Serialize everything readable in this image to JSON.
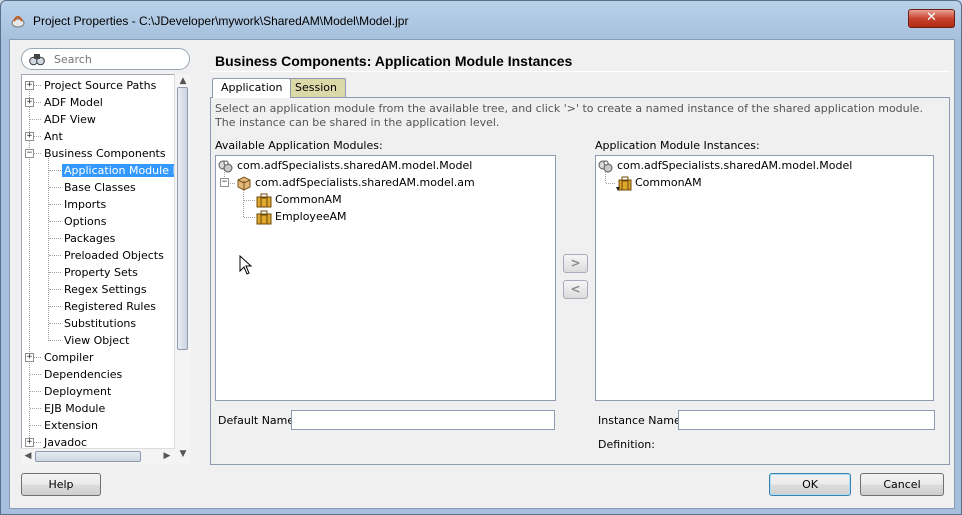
{
  "window": {
    "title": "Project Properties - C:\\JDeveloper\\mywork\\SharedAM\\Model\\Model.jpr",
    "close_label": "✕"
  },
  "search": {
    "placeholder": "Search",
    "value": ""
  },
  "nav": {
    "items": [
      {
        "label": "Project Source Paths",
        "expander": "+"
      },
      {
        "label": "ADF Model",
        "expander": "+"
      },
      {
        "label": "ADF View"
      },
      {
        "label": "Ant",
        "expander": "+"
      },
      {
        "label": "Business Components",
        "expander": "−"
      },
      {
        "label": "Application Module Inst",
        "selected": true
      },
      {
        "label": "Base Classes"
      },
      {
        "label": "Imports"
      },
      {
        "label": "Options"
      },
      {
        "label": "Packages"
      },
      {
        "label": "Preloaded Objects"
      },
      {
        "label": "Property Sets"
      },
      {
        "label": "Regex Settings"
      },
      {
        "label": "Registered Rules"
      },
      {
        "label": "Substitutions"
      },
      {
        "label": "View Object"
      },
      {
        "label": "Compiler",
        "expander": "+"
      },
      {
        "label": "Dependencies"
      },
      {
        "label": "Deployment"
      },
      {
        "label": "EJB Module"
      },
      {
        "label": "Extension"
      },
      {
        "label": "Javadoc",
        "expander": "+"
      }
    ]
  },
  "main": {
    "title": "Business Components: Application Module Instances",
    "tabs": [
      {
        "label": "Application",
        "active": true
      },
      {
        "label": "Session",
        "active": false
      }
    ],
    "description": "Select an application module from the available tree, and click '>' to create a named instance of the shared application module. The instance can be shared in the application level.",
    "available": {
      "label": "Available Application Modules:",
      "nodes": [
        {
          "label": "com.adfSpecialists.sharedAM.model.Model",
          "icon": "project-icon"
        },
        {
          "label": "com.adfSpecialists.sharedAM.model.am",
          "icon": "package-icon",
          "expander": "−"
        },
        {
          "label": "CommonAM",
          "icon": "application-module-icon"
        },
        {
          "label": "EmployeeAM",
          "icon": "application-module-icon"
        }
      ]
    },
    "instances": {
      "label": "Application Module Instances:",
      "nodes": [
        {
          "label": "com.adfSpecialists.sharedAM.model.Model",
          "icon": "project-icon"
        },
        {
          "label": "CommonAM",
          "icon": "application-module-instance-icon"
        }
      ]
    },
    "add_label": ">",
    "remove_label": "<",
    "default_name": {
      "label": "Default Name:",
      "value": ""
    },
    "instance_name": {
      "label": "Instance Name:",
      "value": ""
    },
    "definition_label": "Definition:"
  },
  "buttons": {
    "help": "Help",
    "ok": "OK",
    "cancel": "Cancel"
  }
}
